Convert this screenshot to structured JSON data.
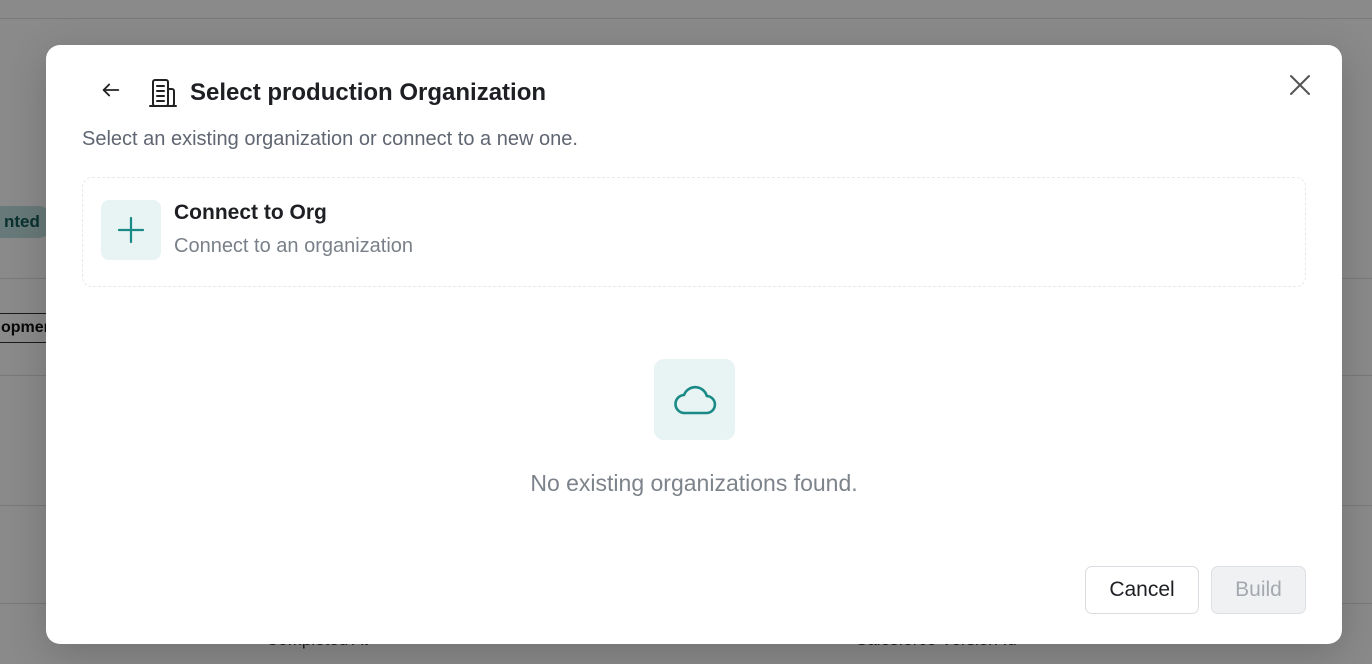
{
  "background": {
    "badge_text": "nted",
    "chip_text": "opmer",
    "footer_left": "Completed At",
    "footer_right": "Salesforce Version Id"
  },
  "modal": {
    "title": "Select production Organization",
    "subtitle": "Select an existing organization or connect to a new one.",
    "connect_card": {
      "title": "Connect to Org",
      "description": "Connect to an organization"
    },
    "empty_state": {
      "message": "No existing organizations found."
    },
    "buttons": {
      "cancel": "Cancel",
      "build": "Build"
    },
    "icons": {
      "back": "arrow-left-icon",
      "title": "building-icon",
      "close": "close-icon",
      "connect": "plus-icon",
      "empty": "cloud-icon"
    },
    "colors": {
      "accent": "#1a8a86",
      "icon_bg": "#e8f3f3"
    }
  }
}
